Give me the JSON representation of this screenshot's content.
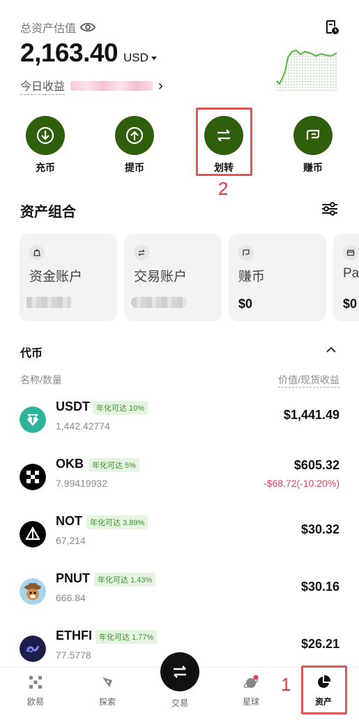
{
  "header": {
    "total_label": "总资产估值",
    "balance": "2,163.40",
    "currency": "USD",
    "today_label": "今日收益"
  },
  "actions": [
    {
      "label": "充币",
      "icon": "deposit-icon"
    },
    {
      "label": "提币",
      "icon": "withdraw-icon"
    },
    {
      "label": "划转",
      "icon": "transfer-icon"
    },
    {
      "label": "赚币",
      "icon": "earn-icon"
    }
  ],
  "annotations": {
    "step1": "1",
    "step2": "2",
    "highlight_color": "#e05555"
  },
  "portfolio": {
    "title": "资产组合",
    "accounts": [
      {
        "name": "资金账户",
        "value": ""
      },
      {
        "name": "交易账户",
        "value": ""
      },
      {
        "name": "赚币",
        "value": "$0"
      },
      {
        "name": "Pay",
        "value": "$0"
      }
    ]
  },
  "tokens_section": {
    "title": "代币",
    "col_left": "名称/数量",
    "col_right": "价值/现货收益",
    "items": [
      {
        "symbol": "USDT",
        "badge": "年化可达 10%",
        "qty": "1,442.42774",
        "value": "$1,441.49",
        "pnl": ""
      },
      {
        "symbol": "OKB",
        "badge": "年化可达 5%",
        "qty": "7.99419932",
        "value": "$605.32",
        "pnl": "-$68.72(-10.20%)"
      },
      {
        "symbol": "NOT",
        "badge": "年化可达 3.89%",
        "qty": "67,214",
        "value": "$30.32",
        "pnl": ""
      },
      {
        "symbol": "PNUT",
        "badge": "年化可达 1.43%",
        "qty": "666.84",
        "value": "$30.16",
        "pnl": ""
      },
      {
        "symbol": "ETHFI",
        "badge": "年化可达 1.77%",
        "qty": "77.5778",
        "value": "$26.21",
        "pnl": ""
      }
    ]
  },
  "nav": {
    "items": [
      {
        "label": "欧易",
        "icon": "okx-logo-icon"
      },
      {
        "label": "探索",
        "icon": "explore-icon"
      },
      {
        "label": "交易",
        "icon": "trade-icon"
      },
      {
        "label": "星球",
        "icon": "planet-icon"
      },
      {
        "label": "资产",
        "icon": "assets-pie-icon"
      }
    ]
  },
  "colors": {
    "brand_green": "#2f5f0a",
    "accent_green": "#3a8f2e",
    "loss_red": "#e0435e"
  }
}
